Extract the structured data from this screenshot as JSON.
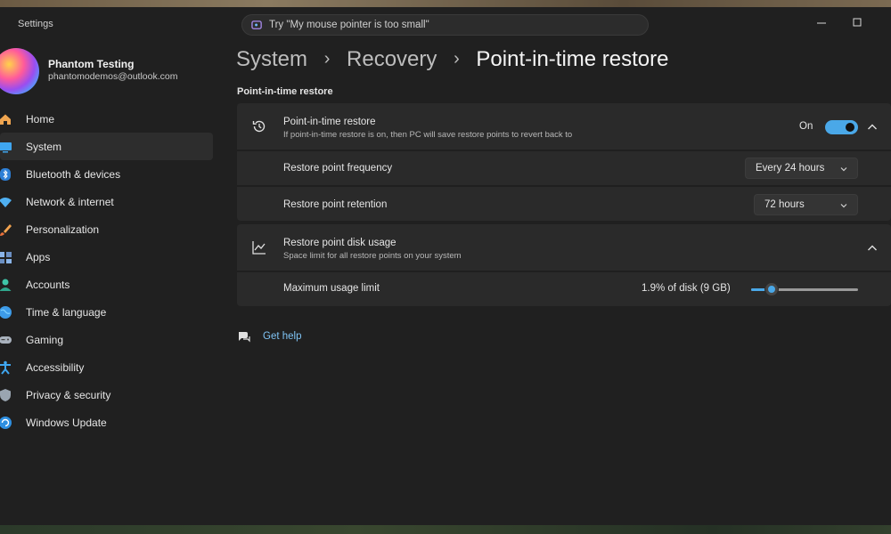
{
  "window": {
    "app_title": "Settings",
    "search_placeholder": "Try \"My mouse pointer is too small\""
  },
  "profile": {
    "name": "Phantom Testing",
    "email": "phantomodemos@outlook.com"
  },
  "sidebar": {
    "items": [
      {
        "label": "Home",
        "icon": "home-icon",
        "selected": false
      },
      {
        "label": "System",
        "icon": "system-icon",
        "selected": true
      },
      {
        "label": "Bluetooth & devices",
        "icon": "bluetooth-icon",
        "selected": false
      },
      {
        "label": "Network & internet",
        "icon": "wifi-icon",
        "selected": false
      },
      {
        "label": "Personalization",
        "icon": "brush-icon",
        "selected": false
      },
      {
        "label": "Apps",
        "icon": "apps-icon",
        "selected": false
      },
      {
        "label": "Accounts",
        "icon": "person-icon",
        "selected": false
      },
      {
        "label": "Time & language",
        "icon": "globe-icon",
        "selected": false
      },
      {
        "label": "Gaming",
        "icon": "gamepad-icon",
        "selected": false
      },
      {
        "label": "Accessibility",
        "icon": "accessibility-icon",
        "selected": false
      },
      {
        "label": "Privacy & security",
        "icon": "shield-icon",
        "selected": false
      },
      {
        "label": "Windows Update",
        "icon": "update-icon",
        "selected": false
      }
    ]
  },
  "breadcrumb": {
    "items": [
      "System",
      "Recovery",
      "Point-in-time restore"
    ]
  },
  "section_title": "Point-in-time restore",
  "restore_card": {
    "title": "Point-in-time restore",
    "description": "If point-in-time restore is on, then PC will save restore points to revert back to",
    "toggle_label": "On",
    "toggle_on": true,
    "frequency_label": "Restore point frequency",
    "frequency_value": "Every 24 hours",
    "retention_label": "Restore point retention",
    "retention_value": "72 hours"
  },
  "disk_card": {
    "title": "Restore point disk usage",
    "description": "Space limit for all restore points on your system",
    "max_label": "Maximum usage limit",
    "max_value": "1.9% of disk (9 GB)",
    "slider_fraction": 0.19
  },
  "help": {
    "label": "Get help"
  },
  "colors": {
    "accent": "#4aa8e8",
    "background": "#202020",
    "card": "#2a2a2a"
  }
}
